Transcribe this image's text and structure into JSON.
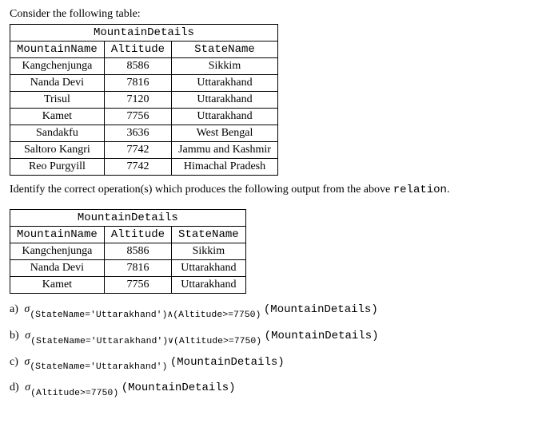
{
  "intro": "Consider the following table:",
  "table1": {
    "title": "MountainDetails",
    "headers": [
      "MountainName",
      "Altitude",
      "StateName"
    ],
    "rows": [
      [
        "Kangchenjunga",
        "8586",
        "Sikkim"
      ],
      [
        "Nanda Devi",
        "7816",
        "Uttarakhand"
      ],
      [
        "Trisul",
        "7120",
        "Uttarakhand"
      ],
      [
        "Kamet",
        "7756",
        "Uttarakhand"
      ],
      [
        "Sandakfu",
        "3636",
        "West Bengal"
      ],
      [
        "Saltoro Kangri",
        "7742",
        "Jammu and Kashmir"
      ],
      [
        "Reo Purgyill",
        "7742",
        "Himachal Pradesh"
      ]
    ]
  },
  "prompt_prefix": "Identify the correct operation(s) which produces the following output from the above ",
  "prompt_code": "relation",
  "prompt_suffix": ".",
  "table2": {
    "title": "MountainDetails",
    "headers": [
      "MountainName",
      "Altitude",
      "StateName"
    ],
    "rows": [
      [
        "Kangchenjunga",
        "8586",
        "Sikkim"
      ],
      [
        "Nanda Devi",
        "7816",
        "Uttarakhand"
      ],
      [
        "Kamet",
        "7756",
        "Uttarakhand"
      ]
    ]
  },
  "sigma": "σ",
  "options": [
    {
      "label": "a)",
      "sub": "(StateName='Uttarakhand')∧(Altitude>=7750)",
      "rel": "(MountainDetails)"
    },
    {
      "label": "b)",
      "sub": "(StateName='Uttarakhand')∨(Altitude>=7750)",
      "rel": "(MountainDetails)"
    },
    {
      "label": "c)",
      "sub": "(StateName='Uttarakhand')",
      "rel": "(MountainDetails)"
    },
    {
      "label": "d)",
      "sub": "(Altitude>=7750)",
      "rel": "(MountainDetails)"
    }
  ]
}
